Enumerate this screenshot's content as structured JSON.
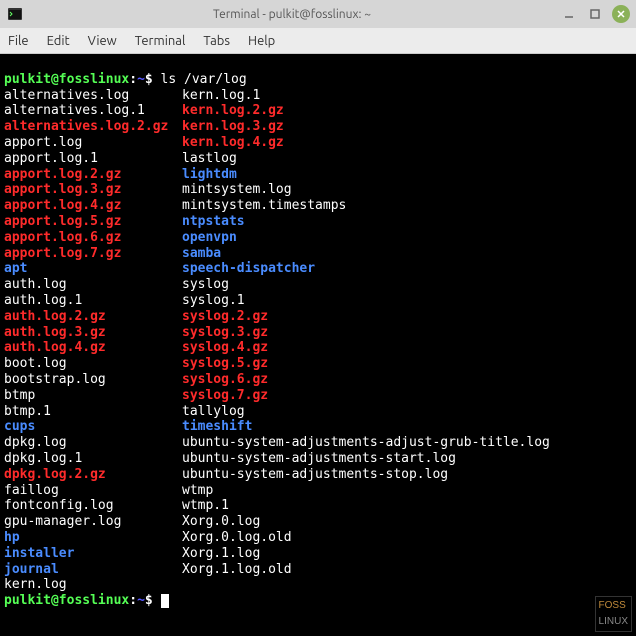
{
  "titlebar": {
    "title": "Terminal - pulkit@fosslinux: ~"
  },
  "menubar": {
    "file": "File",
    "edit": "Edit",
    "view": "View",
    "terminal": "Terminal",
    "tabs": "Tabs",
    "help": "Help"
  },
  "prompt": {
    "user_host": "pulkit@fosslinux",
    "separator": ":",
    "path": "~",
    "suffix": "$ "
  },
  "command": "ls /var/log",
  "listing": [
    {
      "c1": {
        "text": "alternatives.log",
        "cls": "f-plain"
      },
      "c2": {
        "text": "kern.log.1",
        "cls": "f-plain"
      }
    },
    {
      "c1": {
        "text": "alternatives.log.1",
        "cls": "f-plain"
      },
      "c2": {
        "text": "kern.log.2.gz",
        "cls": "f-red"
      }
    },
    {
      "c1": {
        "text": "alternatives.log.2.gz",
        "cls": "f-red"
      },
      "c2": {
        "text": "kern.log.3.gz",
        "cls": "f-red"
      }
    },
    {
      "c1": {
        "text": "apport.log",
        "cls": "f-plain"
      },
      "c2": {
        "text": "kern.log.4.gz",
        "cls": "f-red"
      }
    },
    {
      "c1": {
        "text": "apport.log.1",
        "cls": "f-plain"
      },
      "c2": {
        "text": "lastlog",
        "cls": "f-plain"
      }
    },
    {
      "c1": {
        "text": "apport.log.2.gz",
        "cls": "f-red"
      },
      "c2": {
        "text": "lightdm",
        "cls": "f-blue"
      }
    },
    {
      "c1": {
        "text": "apport.log.3.gz",
        "cls": "f-red"
      },
      "c2": {
        "text": "mintsystem.log",
        "cls": "f-plain"
      }
    },
    {
      "c1": {
        "text": "apport.log.4.gz",
        "cls": "f-red"
      },
      "c2": {
        "text": "mintsystem.timestamps",
        "cls": "f-plain"
      }
    },
    {
      "c1": {
        "text": "apport.log.5.gz",
        "cls": "f-red"
      },
      "c2": {
        "text": "ntpstats",
        "cls": "f-blue"
      }
    },
    {
      "c1": {
        "text": "apport.log.6.gz",
        "cls": "f-red"
      },
      "c2": {
        "text": "openvpn",
        "cls": "f-blue"
      }
    },
    {
      "c1": {
        "text": "apport.log.7.gz",
        "cls": "f-red"
      },
      "c2": {
        "text": "samba",
        "cls": "f-blue"
      }
    },
    {
      "c1": {
        "text": "apt",
        "cls": "f-blue"
      },
      "c2": {
        "text": "speech-dispatcher",
        "cls": "f-blue"
      }
    },
    {
      "c1": {
        "text": "auth.log",
        "cls": "f-plain"
      },
      "c2": {
        "text": "syslog",
        "cls": "f-plain"
      }
    },
    {
      "c1": {
        "text": "auth.log.1",
        "cls": "f-plain"
      },
      "c2": {
        "text": "syslog.1",
        "cls": "f-plain"
      }
    },
    {
      "c1": {
        "text": "auth.log.2.gz",
        "cls": "f-red"
      },
      "c2": {
        "text": "syslog.2.gz",
        "cls": "f-red"
      }
    },
    {
      "c1": {
        "text": "auth.log.3.gz",
        "cls": "f-red"
      },
      "c2": {
        "text": "syslog.3.gz",
        "cls": "f-red"
      }
    },
    {
      "c1": {
        "text": "auth.log.4.gz",
        "cls": "f-red"
      },
      "c2": {
        "text": "syslog.4.gz",
        "cls": "f-red"
      }
    },
    {
      "c1": {
        "text": "boot.log",
        "cls": "f-plain"
      },
      "c2": {
        "text": "syslog.5.gz",
        "cls": "f-red"
      }
    },
    {
      "c1": {
        "text": "bootstrap.log",
        "cls": "f-plain"
      },
      "c2": {
        "text": "syslog.6.gz",
        "cls": "f-red"
      }
    },
    {
      "c1": {
        "text": "btmp",
        "cls": "f-plain"
      },
      "c2": {
        "text": "syslog.7.gz",
        "cls": "f-red"
      }
    },
    {
      "c1": {
        "text": "btmp.1",
        "cls": "f-plain"
      },
      "c2": {
        "text": "tallylog",
        "cls": "f-plain"
      }
    },
    {
      "c1": {
        "text": "cups",
        "cls": "f-blue"
      },
      "c2": {
        "text": "timeshift",
        "cls": "f-blue"
      }
    },
    {
      "c1": {
        "text": "dpkg.log",
        "cls": "f-plain"
      },
      "c2": {
        "text": "ubuntu-system-adjustments-adjust-grub-title.log",
        "cls": "f-plain"
      }
    },
    {
      "c1": {
        "text": "dpkg.log.1",
        "cls": "f-plain"
      },
      "c2": {
        "text": "ubuntu-system-adjustments-start.log",
        "cls": "f-plain"
      }
    },
    {
      "c1": {
        "text": "dpkg.log.2.gz",
        "cls": "f-red"
      },
      "c2": {
        "text": "ubuntu-system-adjustments-stop.log",
        "cls": "f-plain"
      }
    },
    {
      "c1": {
        "text": "faillog",
        "cls": "f-plain"
      },
      "c2": {
        "text": "wtmp",
        "cls": "f-plain"
      }
    },
    {
      "c1": {
        "text": "fontconfig.log",
        "cls": "f-plain"
      },
      "c2": {
        "text": "wtmp.1",
        "cls": "f-plain"
      }
    },
    {
      "c1": {
        "text": "gpu-manager.log",
        "cls": "f-plain"
      },
      "c2": {
        "text": "Xorg.0.log",
        "cls": "f-plain"
      }
    },
    {
      "c1": {
        "text": "hp",
        "cls": "f-blue"
      },
      "c2": {
        "text": "Xorg.0.log.old",
        "cls": "f-plain"
      }
    },
    {
      "c1": {
        "text": "installer",
        "cls": "f-blue"
      },
      "c2": {
        "text": "Xorg.1.log",
        "cls": "f-plain"
      }
    },
    {
      "c1": {
        "text": "journal",
        "cls": "f-blue"
      },
      "c2": {
        "text": "Xorg.1.log.old",
        "cls": "f-plain"
      }
    },
    {
      "c1": {
        "text": "kern.log",
        "cls": "f-plain"
      },
      "c2": null
    }
  ],
  "watermark": {
    "line1": "FOSS",
    "line2": "LINUX"
  }
}
